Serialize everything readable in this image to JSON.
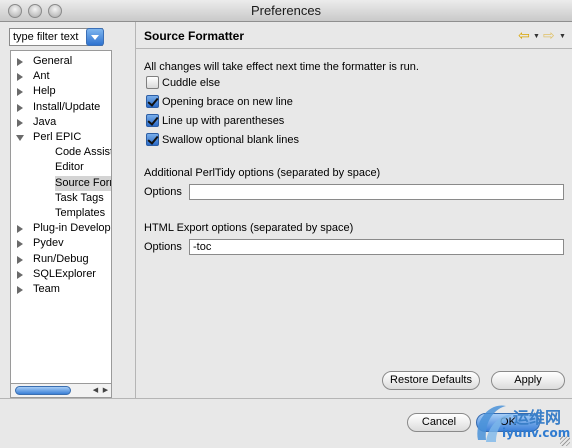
{
  "window": {
    "title": "Preferences"
  },
  "filter": {
    "value": "type filter text"
  },
  "tree": {
    "items": [
      {
        "label": "General",
        "level": 0,
        "expanded": false,
        "selected": false
      },
      {
        "label": "Ant",
        "level": 0,
        "expanded": false,
        "selected": false
      },
      {
        "label": "Help",
        "level": 0,
        "expanded": false,
        "selected": false
      },
      {
        "label": "Install/Update",
        "level": 0,
        "expanded": false,
        "selected": false
      },
      {
        "label": "Java",
        "level": 0,
        "expanded": false,
        "selected": false
      },
      {
        "label": "Perl EPIC",
        "level": 0,
        "expanded": true,
        "selected": false
      },
      {
        "label": "Code Assist",
        "level": 1,
        "expanded": false,
        "selected": false
      },
      {
        "label": "Editor",
        "level": 1,
        "expanded": false,
        "selected": false
      },
      {
        "label": "Source Form",
        "level": 1,
        "expanded": false,
        "selected": true
      },
      {
        "label": "Task Tags",
        "level": 1,
        "expanded": false,
        "selected": false
      },
      {
        "label": "Templates",
        "level": 1,
        "expanded": false,
        "selected": false
      },
      {
        "label": "Plug-in Developm",
        "level": 0,
        "expanded": false,
        "selected": false
      },
      {
        "label": "Pydev",
        "level": 0,
        "expanded": false,
        "selected": false
      },
      {
        "label": "Run/Debug",
        "level": 0,
        "expanded": false,
        "selected": false
      },
      {
        "label": "SQLExplorer",
        "level": 0,
        "expanded": false,
        "selected": false
      },
      {
        "label": "Team",
        "level": 0,
        "expanded": false,
        "selected": false
      }
    ]
  },
  "page": {
    "title": "Source Formatter",
    "note": "All changes will take effect next time the formatter is run.",
    "checkboxes": [
      {
        "label": "Cuddle else",
        "checked": false
      },
      {
        "label": "Opening brace on new line",
        "checked": true
      },
      {
        "label": "Line up with parentheses",
        "checked": true
      },
      {
        "label": "Swallow optional blank lines",
        "checked": true
      }
    ],
    "perltidy": {
      "heading": "Additional PerlTidy options (separated by space)",
      "label": "Options",
      "value": ""
    },
    "html_export": {
      "heading": "HTML Export options (separated by space)",
      "label": "Options",
      "value": "-toc"
    }
  },
  "buttons": {
    "restore_defaults": "Restore Defaults",
    "apply": "Apply",
    "cancel": "Cancel",
    "ok": "OK"
  },
  "icons": {
    "back": "back-arrow-icon",
    "forward": "forward-arrow-icon"
  },
  "watermark": {
    "line1": "运维网",
    "line2": "iyunv.com"
  },
  "colors": {
    "accent": "#3c80d9",
    "selection": "#d4d4d4"
  }
}
